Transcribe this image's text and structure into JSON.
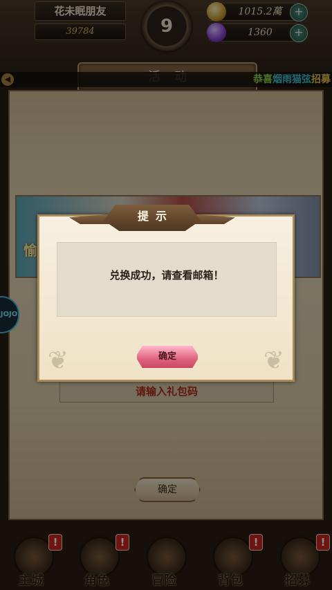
{
  "player": {
    "name": "花未眠朋友",
    "power": "39784",
    "level": "9"
  },
  "resources": {
    "gold": "1015.2萬",
    "gems": "1360"
  },
  "marquee": {
    "prefix": "恭喜",
    "name": "烟雨猫弦",
    "suffix": "招募"
  },
  "activity": {
    "title": "活动",
    "banner_text": "愉",
    "side_badge": "JOJO",
    "gift_code_placeholder": "请输入礼包码",
    "confirm_label": "确定"
  },
  "dialog": {
    "title": "提示",
    "message": "兑换成功，请查看邮箱！",
    "confirm_label": "确定"
  },
  "nav": {
    "items": [
      {
        "label": "主城",
        "alert": "!"
      },
      {
        "label": "角色",
        "alert": "!"
      },
      {
        "label": "冒险",
        "alert": ""
      },
      {
        "label": "背包",
        "alert": "!"
      },
      {
        "label": "招募",
        "alert": "!"
      }
    ]
  }
}
